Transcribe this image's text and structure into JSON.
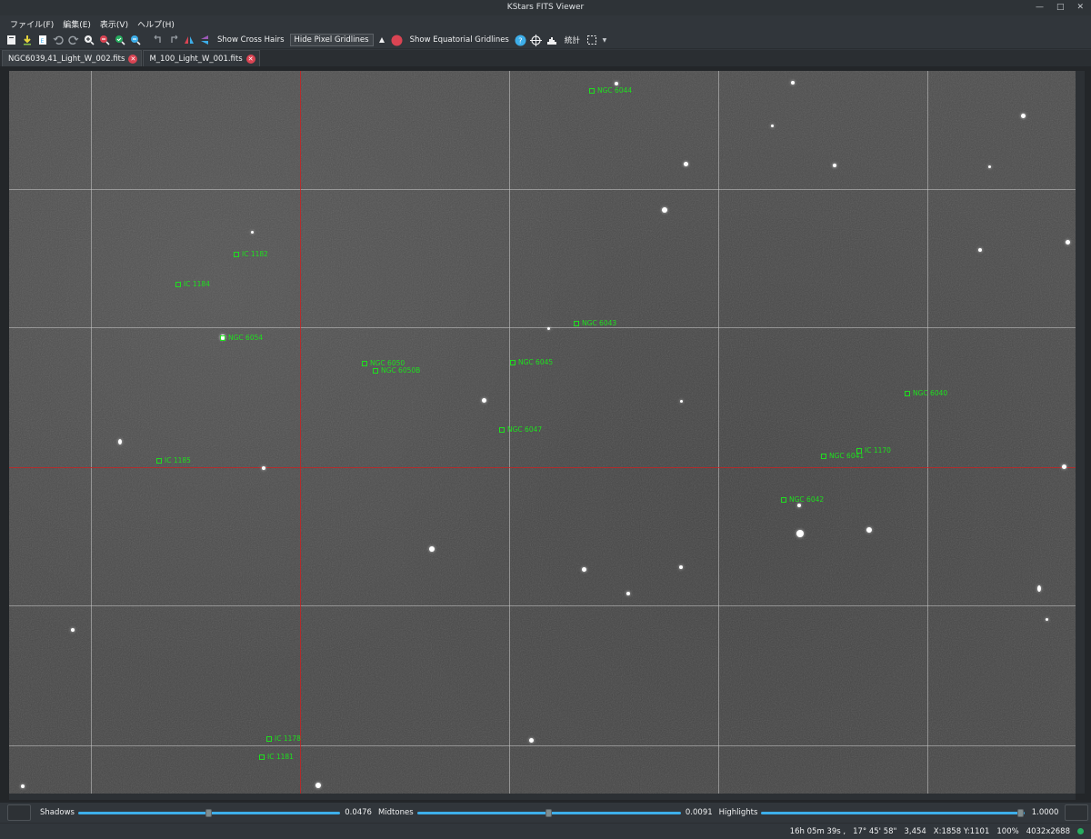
{
  "window": {
    "title": "KStars FITS Viewer"
  },
  "menu": [
    {
      "label": "ファイル(F)"
    },
    {
      "label": "編集(E)"
    },
    {
      "label": "表示(V)"
    },
    {
      "label": "ヘルプ(H)"
    }
  ],
  "toolbar": {
    "show_cross_hairs": "Show Cross Hairs",
    "hide_pixel_gridlines": "Hide Pixel Gridlines",
    "show_equatorial_gridlines": "Show Equatorial Gridlines",
    "statistics": "統計"
  },
  "tabs": [
    {
      "label": "NGC6039,41_Light_W_002.fits",
      "active": true
    },
    {
      "label": "M_100_Light_W_001.fits",
      "active": false
    }
  ],
  "objects": [
    {
      "label": "NGC 6044"
    },
    {
      "label": "IC 1182"
    },
    {
      "label": "IC 1184"
    },
    {
      "label": "NGC 6043"
    },
    {
      "label": "NGC 6054"
    },
    {
      "label": "NGC 6050"
    },
    {
      "label": "NGC 6050B"
    },
    {
      "label": "NGC 6045"
    },
    {
      "label": "NGC 6040"
    },
    {
      "label": "NGC 6047"
    },
    {
      "label": "IC 1170"
    },
    {
      "label": "NGC 6041"
    },
    {
      "label": "IC 1185"
    },
    {
      "label": "NGC 6042"
    },
    {
      "label": "IC 1178"
    },
    {
      "label": "IC 1181"
    }
  ],
  "stretch": {
    "shadows_label": "Shadows",
    "shadows_value": "0.0476",
    "shadows_level": 0.0476,
    "midtones_label": "Midtones",
    "midtones_value": "0.0091",
    "midtones_level": 0.0091,
    "highlights_label": "Highlights",
    "highlights_value": "1.0000",
    "highlights_level": 1.0
  },
  "status": {
    "ra": "16h 05m 39s ,",
    "dec": "17° 45' 58\"",
    "value": "3,454",
    "pixel": "X:1858 Y:1101",
    "zoom": "100%",
    "size": "4032x2688"
  },
  "colors": {
    "object_marker": "#1ee01e",
    "crosshair": "#d21e1e",
    "slider_accent": "#3daee9"
  }
}
